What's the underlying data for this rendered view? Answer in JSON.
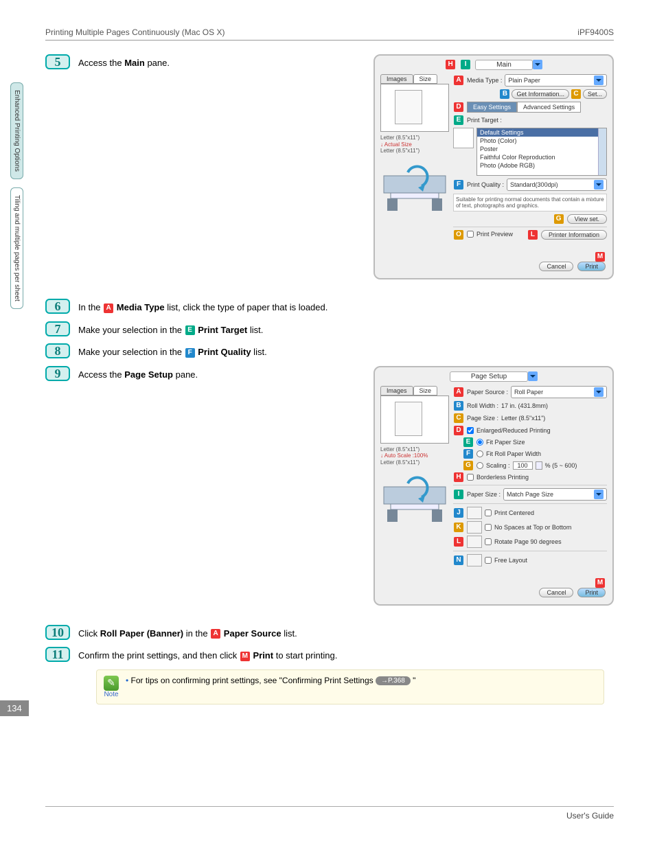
{
  "header": {
    "left": "Printing Multiple Pages Continuously (Mac OS X)",
    "right": "iPF9400S"
  },
  "sideTabs": {
    "t1": "Enhanced Printing Options",
    "t2": "Tiling and multiple pages per sheet"
  },
  "steps": {
    "s5": {
      "num": "5",
      "pre": "Access the ",
      "bold": "Main",
      "post": " pane."
    },
    "s6": {
      "num": "6",
      "pre": "In the ",
      "letter": "A",
      "bold": "Media Type",
      "post": " list, click the type of paper that is loaded."
    },
    "s7": {
      "num": "7",
      "pre": "Make your selection in the ",
      "letter": "E",
      "bold": "Print Target",
      "post": " list."
    },
    "s8": {
      "num": "8",
      "pre": "Make your selection in the ",
      "letter": "F",
      "bold": "Print Quality",
      "post": " list."
    },
    "s9": {
      "num": "9",
      "pre": "Access the ",
      "bold": "Page Setup",
      "post": " pane."
    },
    "s10": {
      "num": "10",
      "pre": "Click ",
      "bold": "Roll Paper (Banner)",
      "mid": " in the ",
      "letter": "A",
      "bold2": "Paper Source",
      "post": " list."
    },
    "s11": {
      "num": "11",
      "pre": "Confirm the print settings, and then click ",
      "letter": "M",
      "bold": "Print",
      "post": " to start printing."
    }
  },
  "note": {
    "label": "Note",
    "text": "For tips on confirming print settings, see \"Confirming Print Settings ",
    "ref": "→P.368",
    "tail": " \""
  },
  "fig1": {
    "paneName": "Main",
    "tabs": {
      "images": "Images",
      "size": "Size"
    },
    "previewInfo": {
      "l1": "Letter (8.5\"x11\")",
      "l2": "Actual Size",
      "l3": "Letter (8.5\"x11\")"
    },
    "mediaTypeLabel": "Media Type :",
    "mediaTypeValue": "Plain Paper",
    "getInfo": "Get Information...",
    "set": "Set...",
    "easy": "Easy Settings",
    "adv": "Advanced Settings",
    "printTargetLabel": "Print Target :",
    "targets": {
      "t1": "Default Settings",
      "t2": "Photo (Color)",
      "t3": "Poster",
      "t4": "Faithful Color Reproduction",
      "t5": "Photo (Adobe RGB)"
    },
    "printQualityLabel": "Print Quality :",
    "printQualityValue": "Standard(300dpi)",
    "qualityDesc": "Suitable for printing normal documents that contain a mixture of text, photographs and graphics.",
    "viewSet": "View set.",
    "printPreview": "Print Preview",
    "printerInfo": "Printer Information",
    "cancel": "Cancel",
    "print": "Print"
  },
  "fig2": {
    "paneName": "Page Setup",
    "tabs": {
      "images": "Images",
      "size": "Size"
    },
    "previewInfo": {
      "l1": "Letter (8.5\"x11\")",
      "l2": "Auto Scale :100%",
      "l3": "Letter (8.5\"x11\")"
    },
    "paperSourceLabel": "Paper Source :",
    "paperSourceValue": "Roll Paper",
    "rollWidthLabel": "Roll Width :",
    "rollWidthValue": "17 in. (431.8mm)",
    "pageSizeLabel": "Page Size :",
    "pageSizeValue": "Letter (8.5\"x11\")",
    "enlarged": "Enlarged/Reduced Printing",
    "fitPaper": "Fit Paper Size",
    "fitRoll": "Fit Roll Paper Width",
    "scalingLabel": "Scaling :",
    "scalingValue": "100",
    "scalingRange": "% (5 ~ 600)",
    "borderless": "Borderless Printing",
    "paperSizeLabel": "Paper Size :",
    "paperSizeValue": "Match Page Size",
    "printCentered": "Print Centered",
    "noSpaces": "No Spaces at Top or Bottom",
    "rotate": "Rotate Page 90 degrees",
    "freeLayout": "Free Layout",
    "cancel": "Cancel",
    "print": "Print"
  },
  "pageNum": "134",
  "footer": "User's Guide"
}
